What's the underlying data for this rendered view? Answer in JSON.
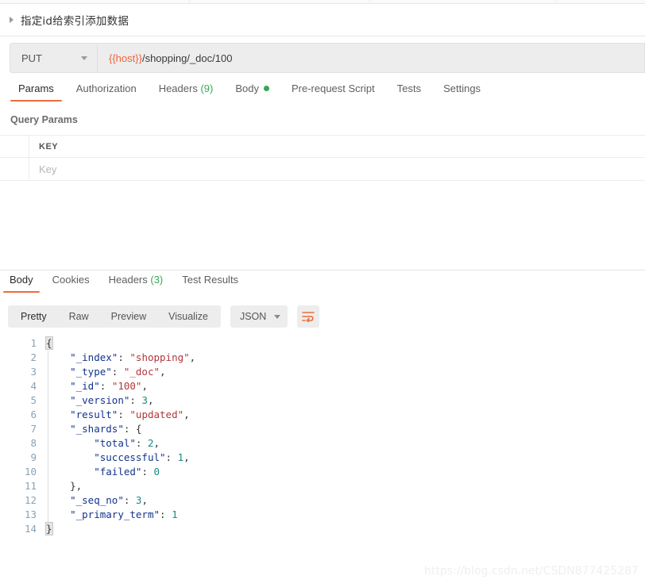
{
  "window": {
    "tab_dividers": [
      238,
      465,
      700
    ]
  },
  "request": {
    "title": "指定id给索引添加数据",
    "collapse_icon": "caret-right-icon",
    "method": "PUT",
    "method_dropdown_icon": "chevron-down-icon",
    "url_variable": "{{host}}",
    "url_path": "/shopping/_doc/100",
    "tabs": [
      {
        "label": "Params",
        "active": true,
        "badge": null,
        "dot": false
      },
      {
        "label": "Authorization",
        "active": false,
        "badge": null,
        "dot": false
      },
      {
        "label": "Headers",
        "active": false,
        "badge": "(9)",
        "dot": false
      },
      {
        "label": "Body",
        "active": false,
        "badge": null,
        "dot": true
      },
      {
        "label": "Pre-request Script",
        "active": false,
        "badge": null,
        "dot": false
      },
      {
        "label": "Tests",
        "active": false,
        "badge": null,
        "dot": false
      },
      {
        "label": "Settings",
        "active": false,
        "badge": null,
        "dot": false
      }
    ],
    "params_section_label": "Query Params",
    "params_table": {
      "columns": [
        "KEY"
      ],
      "rows": [
        {
          "key_placeholder": "Key"
        }
      ]
    }
  },
  "response": {
    "tabs": [
      {
        "label": "Body",
        "active": true,
        "badge": null
      },
      {
        "label": "Cookies",
        "active": false,
        "badge": null
      },
      {
        "label": "Headers",
        "active": false,
        "badge": "(3)"
      },
      {
        "label": "Test Results",
        "active": false,
        "badge": null
      }
    ],
    "view_modes": [
      {
        "label": "Pretty",
        "active": true
      },
      {
        "label": "Raw",
        "active": false
      },
      {
        "label": "Preview",
        "active": false
      },
      {
        "label": "Visualize",
        "active": false
      }
    ],
    "format": "JSON",
    "format_dropdown_icon": "chevron-down-icon",
    "wrap_icon": "word-wrap-icon",
    "line_numbers": [
      "1",
      "2",
      "3",
      "4",
      "5",
      "6",
      "7",
      "8",
      "9",
      "10",
      "11",
      "12",
      "13",
      "14"
    ],
    "body_lines": [
      [
        {
          "t": "{",
          "c": "p brace-hl"
        }
      ],
      [
        {
          "t": "    ",
          "c": "p"
        },
        {
          "t": "\"_index\"",
          "c": "k"
        },
        {
          "t": ": ",
          "c": "p"
        },
        {
          "t": "\"shopping\"",
          "c": "s"
        },
        {
          "t": ",",
          "c": "p"
        }
      ],
      [
        {
          "t": "    ",
          "c": "p"
        },
        {
          "t": "\"_type\"",
          "c": "k"
        },
        {
          "t": ": ",
          "c": "p"
        },
        {
          "t": "\"_doc\"",
          "c": "s"
        },
        {
          "t": ",",
          "c": "p"
        }
      ],
      [
        {
          "t": "    ",
          "c": "p"
        },
        {
          "t": "\"_id\"",
          "c": "k"
        },
        {
          "t": ": ",
          "c": "p"
        },
        {
          "t": "\"100\"",
          "c": "s"
        },
        {
          "t": ",",
          "c": "p"
        }
      ],
      [
        {
          "t": "    ",
          "c": "p"
        },
        {
          "t": "\"_version\"",
          "c": "k"
        },
        {
          "t": ": ",
          "c": "p"
        },
        {
          "t": "3",
          "c": "n"
        },
        {
          "t": ",",
          "c": "p"
        }
      ],
      [
        {
          "t": "    ",
          "c": "p"
        },
        {
          "t": "\"result\"",
          "c": "k"
        },
        {
          "t": ": ",
          "c": "p"
        },
        {
          "t": "\"updated\"",
          "c": "s"
        },
        {
          "t": ",",
          "c": "p"
        }
      ],
      [
        {
          "t": "    ",
          "c": "p"
        },
        {
          "t": "\"_shards\"",
          "c": "k"
        },
        {
          "t": ": ",
          "c": "p"
        },
        {
          "t": "{",
          "c": "p"
        }
      ],
      [
        {
          "t": "        ",
          "c": "p"
        },
        {
          "t": "\"total\"",
          "c": "k"
        },
        {
          "t": ": ",
          "c": "p"
        },
        {
          "t": "2",
          "c": "n"
        },
        {
          "t": ",",
          "c": "p"
        }
      ],
      [
        {
          "t": "        ",
          "c": "p"
        },
        {
          "t": "\"successful\"",
          "c": "k"
        },
        {
          "t": ": ",
          "c": "p"
        },
        {
          "t": "1",
          "c": "n"
        },
        {
          "t": ",",
          "c": "p"
        }
      ],
      [
        {
          "t": "        ",
          "c": "p"
        },
        {
          "t": "\"failed\"",
          "c": "k"
        },
        {
          "t": ": ",
          "c": "p"
        },
        {
          "t": "0",
          "c": "n"
        }
      ],
      [
        {
          "t": "    ",
          "c": "p"
        },
        {
          "t": "},",
          "c": "p"
        }
      ],
      [
        {
          "t": "    ",
          "c": "p"
        },
        {
          "t": "\"_seq_no\"",
          "c": "k"
        },
        {
          "t": ": ",
          "c": "p"
        },
        {
          "t": "3",
          "c": "n"
        },
        {
          "t": ",",
          "c": "p"
        }
      ],
      [
        {
          "t": "    ",
          "c": "p"
        },
        {
          "t": "\"_primary_term\"",
          "c": "k"
        },
        {
          "t": ": ",
          "c": "p"
        },
        {
          "t": "1",
          "c": "n"
        }
      ],
      [
        {
          "t": "}",
          "c": "p brace-hl"
        }
      ]
    ]
  },
  "watermark": "https://blog.csdn.net/CSDN877425287",
  "colors": {
    "accent_orange": "#ef6c3a",
    "badge_green": "#3aa757",
    "body_dot_green": "#36a653",
    "json_key": "#14338c",
    "json_string": "#b2373b",
    "json_number": "#1a8a82",
    "gutter": "#8aa2b4",
    "toolbar_bg": "#ededed"
  }
}
